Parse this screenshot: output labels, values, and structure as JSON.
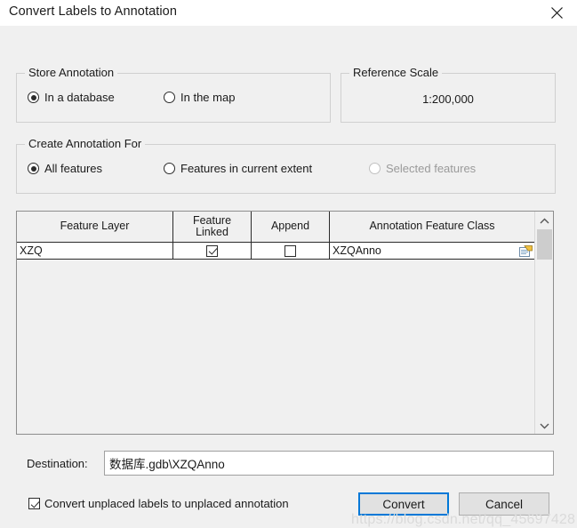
{
  "window": {
    "title": "Convert Labels to Annotation",
    "close_icon": "close-icon"
  },
  "store_annotation": {
    "legend": "Store Annotation",
    "options": [
      {
        "label": "In a database",
        "selected": true,
        "disabled": false
      },
      {
        "label": "In the map",
        "selected": false,
        "disabled": false
      }
    ]
  },
  "reference_scale": {
    "legend": "Reference Scale",
    "value": "1:200,000"
  },
  "create_annotation_for": {
    "legend": "Create Annotation For",
    "options": [
      {
        "label": "All features",
        "selected": true,
        "disabled": false
      },
      {
        "label": "Features in current extent",
        "selected": false,
        "disabled": false
      },
      {
        "label": "Selected features",
        "selected": false,
        "disabled": true
      }
    ]
  },
  "table": {
    "columns": [
      {
        "label": "Feature Layer"
      },
      {
        "label": "Feature",
        "label2": "Linked"
      },
      {
        "label": "Append"
      },
      {
        "label": "Annotation Feature Class"
      }
    ],
    "rows": [
      {
        "feature_layer": "XZQ",
        "feature_linked": true,
        "append": false,
        "annotation_feature_class": "XZQAnno",
        "browse_icon": "browse-dataset-icon"
      }
    ],
    "scrollbar": {
      "up_icon": "chevron-up-icon",
      "down_icon": "chevron-down-icon"
    }
  },
  "destination": {
    "label": "Destination:",
    "value": "数据库.gdb\\XZQAnno",
    "placeholder": ""
  },
  "footer": {
    "unplaced_checkbox": {
      "label": "Convert unplaced labels to unplaced annotation",
      "checked": true
    },
    "convert_button": "Convert",
    "cancel_button": "Cancel"
  },
  "watermark": "https://blog.csdn.net/qq_45697428",
  "colors": {
    "dialog_background": "#f0f0f0",
    "titlebar_background": "#ffffff",
    "focus_border": "#0078d7",
    "field_background": "#ffffff",
    "border": "#8d8d8d",
    "disabled_text": "#9a9a9a"
  }
}
